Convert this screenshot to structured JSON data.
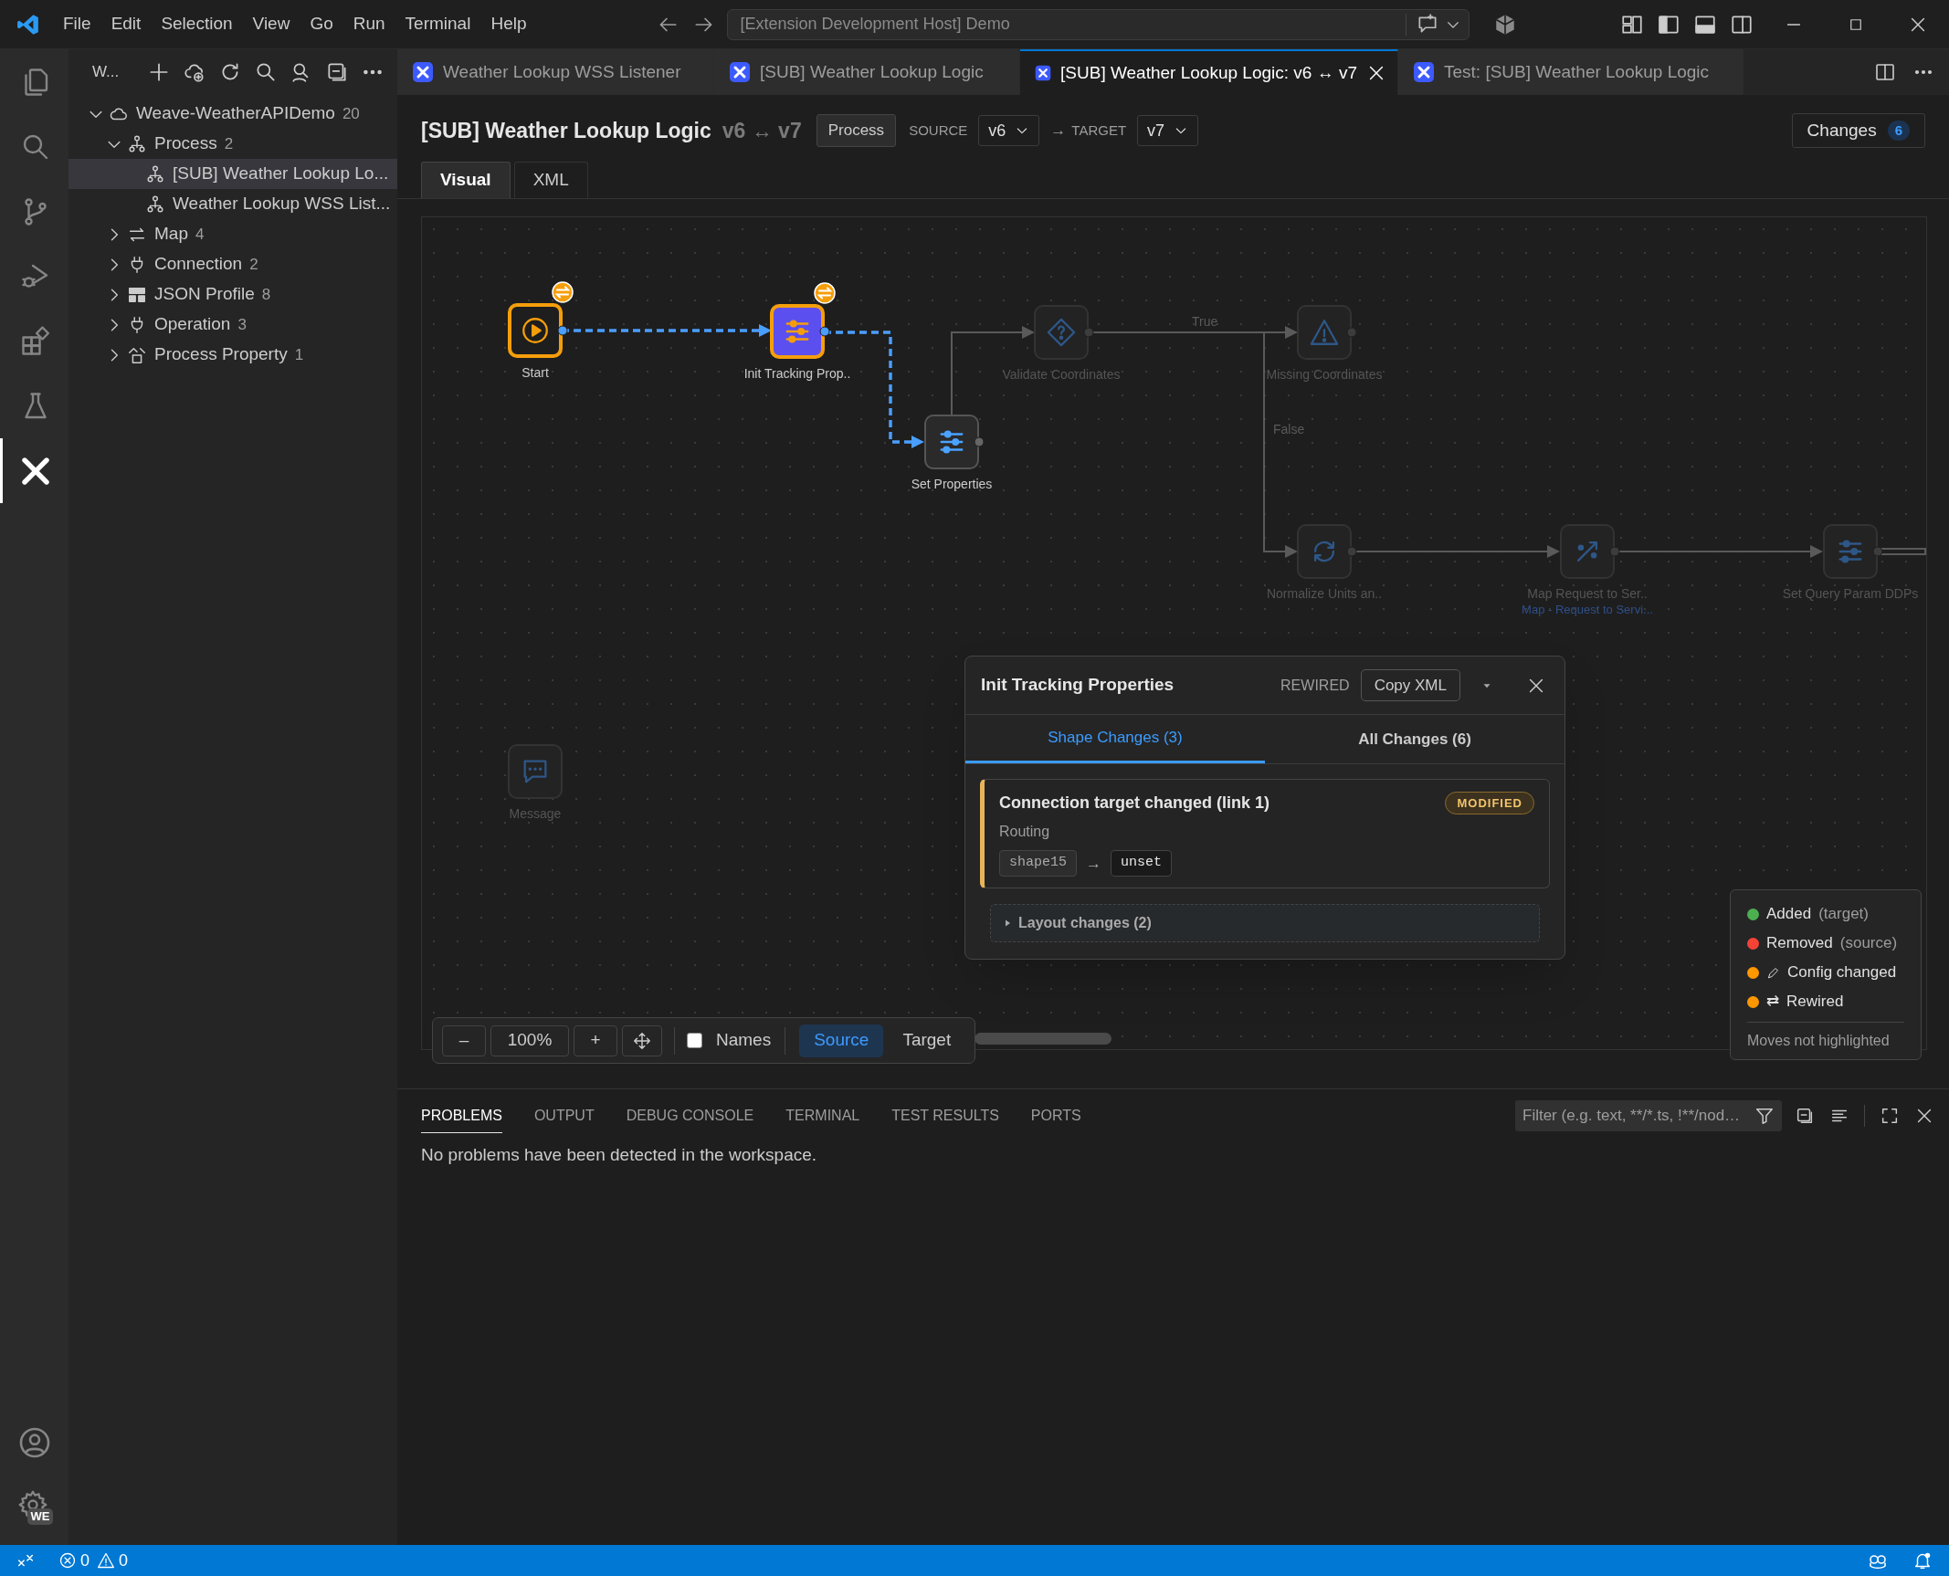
{
  "menu": [
    "File",
    "Edit",
    "Selection",
    "View",
    "Go",
    "Run",
    "Terminal",
    "Help"
  ],
  "command_center": "[Extension Development Host] Demo",
  "activity_bar": [
    {
      "kind": "explorer",
      "selected": false
    },
    {
      "kind": "search",
      "selected": false
    },
    {
      "kind": "source_control",
      "selected": false
    },
    {
      "kind": "run_debug",
      "selected": false
    },
    {
      "kind": "extensions",
      "selected": false
    },
    {
      "kind": "testing",
      "selected": false
    },
    {
      "kind": "weave",
      "selected": true
    }
  ],
  "settings_badge": "WE",
  "sidebar": {
    "title": "W...",
    "tree": [
      {
        "label": "Weave-WeatherAPIDemo",
        "count": "20",
        "kind": "cloud",
        "expanded": true,
        "selected": false,
        "children": [
          {
            "label": "Process",
            "count": "2",
            "kind": "process",
            "expanded": true,
            "selected": false,
            "children": [
              {
                "label": "[SUB] Weather Lookup Lo...",
                "kind": "process",
                "selected": true
              },
              {
                "label": "Weather Lookup WSS List...",
                "kind": "process",
                "selected": false
              }
            ]
          },
          {
            "label": "Map",
            "count": "4",
            "kind": "map",
            "expanded": false,
            "selected": false
          },
          {
            "label": "Connection",
            "count": "2",
            "kind": "plug",
            "expanded": false,
            "selected": false
          },
          {
            "label": "JSON Profile",
            "count": "8",
            "kind": "table",
            "expanded": false,
            "selected": false
          },
          {
            "label": "Operation",
            "count": "3",
            "kind": "plug",
            "expanded": false,
            "selected": false
          },
          {
            "label": "Process Property",
            "count": "1",
            "kind": "property",
            "expanded": false,
            "selected": false
          }
        ]
      }
    ]
  },
  "editor_tabs": [
    {
      "label": "Weather Lookup WSS Listener",
      "selected": false
    },
    {
      "label": "[SUB] Weather Lookup Logic",
      "selected": false
    },
    {
      "label": "[SUB] Weather Lookup Logic: v6 ↔ v7",
      "selected": true
    },
    {
      "label": "Test: [SUB] Weather Lookup Logic",
      "selected": false
    }
  ],
  "diff_header": {
    "title": "[SUB] Weather Lookup Logic",
    "versions": "v6 ↔ v7",
    "type_badge": "Process",
    "source_label": "SOURCE",
    "source": "v6",
    "arrow": "→",
    "target_label": "TARGET",
    "target": "v7",
    "changes_label": "Changes",
    "changes_count": "6"
  },
  "view_tabs": [
    {
      "label": "Visual",
      "selected": true
    },
    {
      "label": "XML",
      "selected": false
    }
  ],
  "canvas": {
    "nodes": [
      {
        "label": "Start",
        "kind": "start",
        "rewired": true,
        "dimmed": false,
        "selected": false
      },
      {
        "label": "Init Tracking Prop..",
        "kind": "set_properties",
        "rewired": true,
        "dimmed": false,
        "selected": true
      },
      {
        "label": "Set Properties",
        "kind": "set_properties",
        "rewired": false,
        "dimmed": false,
        "selected": false
      },
      {
        "label": "Validate Coordinates",
        "kind": "decision",
        "rewired": false,
        "dimmed": true,
        "selected": false
      },
      {
        "label": "Missing Coordinates",
        "kind": "exception",
        "rewired": false,
        "dimmed": true,
        "selected": false
      },
      {
        "label": "Normalize Units an..",
        "kind": "data_process",
        "rewired": false,
        "dimmed": true,
        "selected": false
      },
      {
        "label": "Map Request to Ser..",
        "subtitle": "Map - Request to Servi...",
        "kind": "map",
        "rewired": false,
        "dimmed": true,
        "selected": false
      },
      {
        "label": "Set Query Param DDPs",
        "kind": "set_properties",
        "rewired": false,
        "dimmed": true,
        "selected": false
      },
      {
        "label": "Message",
        "kind": "message",
        "rewired": false,
        "dimmed": true,
        "selected": false
      }
    ],
    "edges": [
      {
        "rewired": true
      },
      {
        "rewired": true
      },
      {
        "rewired": false
      },
      {
        "rewired": false,
        "label": "True"
      },
      {
        "rewired": false,
        "label": "False"
      },
      {
        "rewired": false
      },
      {
        "rewired": false
      },
      {
        "rewired": false
      }
    ]
  },
  "change_panel": {
    "title": "Init Tracking Properties",
    "tag": "REWIRED",
    "copy_button": "Copy XML",
    "tabs": [
      {
        "label": "Shape Changes (3)",
        "selected": true
      },
      {
        "label": "All Changes (6)",
        "selected": false
      }
    ],
    "changes": [
      {
        "title": "Connection target changed (link 1)",
        "badge": "MODIFIED",
        "category": "Routing",
        "from": "shape15",
        "arrow": "→",
        "to": "unset"
      }
    ],
    "layout_section": {
      "label": "Layout changes (2)",
      "expanded": false
    }
  },
  "legend": {
    "items": [
      {
        "label": "Added",
        "note": "(target)",
        "color": "#4caf50",
        "kind": "plain"
      },
      {
        "label": "Removed",
        "note": "(source)",
        "color": "#f44336",
        "kind": "plain"
      },
      {
        "label": "Config changed",
        "color": "#ff9800",
        "kind": "pencil"
      },
      {
        "label": "Rewired",
        "symbol": "⇄",
        "color": "#ff9800",
        "kind": "symbol"
      }
    ],
    "footer": "Moves not highlighted"
  },
  "toolbar": {
    "zoom_out": "–",
    "zoom": "100%",
    "zoom_in": "+",
    "names": {
      "label": "Names",
      "checked": false
    },
    "views": [
      {
        "label": "Source",
        "selected": true
      },
      {
        "label": "Target",
        "selected": false
      }
    ]
  },
  "panel": {
    "tabs": [
      {
        "label": "PROBLEMS",
        "selected": true
      },
      {
        "label": "OUTPUT",
        "selected": false
      },
      {
        "label": "DEBUG CONSOLE",
        "selected": false
      },
      {
        "label": "TERMINAL",
        "selected": false
      },
      {
        "label": "TEST RESULTS",
        "selected": false
      },
      {
        "label": "PORTS",
        "selected": false
      }
    ],
    "filter_placeholder": "Filter (e.g. text, **/*.ts, !**/nod…",
    "message": "No problems have been detected in the workspace."
  },
  "status_bar": {
    "errors": "0",
    "warnings": "0"
  }
}
